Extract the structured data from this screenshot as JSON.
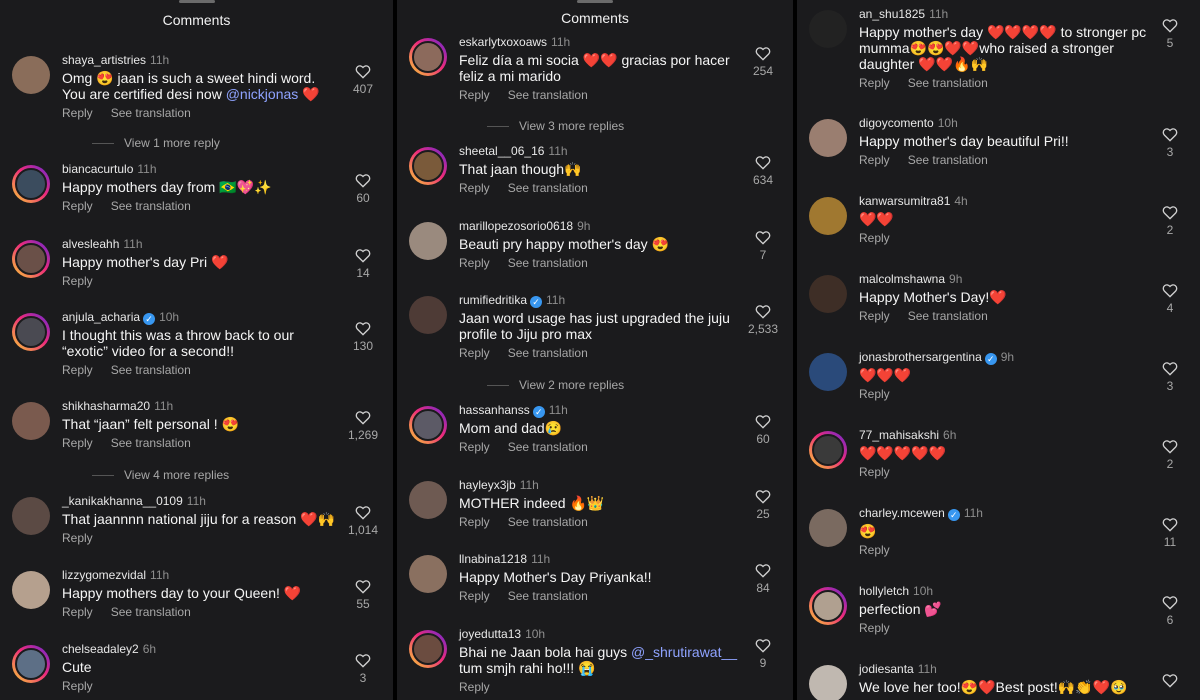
{
  "panels": [
    {
      "title": "Comments",
      "comments": [
        {
          "user": "shaya_artistries",
          "time": "11h",
          "verified": false,
          "text": "Omg 😍 jaan is such a sweet hindi word. You are certified desi now",
          "mention": "@nickjonas",
          "tail": " ❤️",
          "reply": "Reply",
          "translate": "See translation",
          "likes": "407",
          "more": "View 1 more reply",
          "avatar": "#8a6d5a",
          "ring": false
        },
        {
          "user": "biancacurtulo",
          "time": "11h",
          "verified": false,
          "text": "Happy mothers day from 🇧🇷💖✨",
          "reply": "Reply",
          "translate": "See translation",
          "likes": "60",
          "avatar": "#3b4c5e",
          "ring": true
        },
        {
          "user": "alvesleahh",
          "time": "11h",
          "verified": false,
          "text": "Happy mother's day Pri ❤️",
          "reply": "Reply",
          "likes": "14",
          "avatar": "#6a5048",
          "ring": true
        },
        {
          "user": "anjula_acharia",
          "time": "10h",
          "verified": true,
          "text": "I thought this was a throw back to our “exotic” video for a second!!",
          "reply": "Reply",
          "translate": "See translation",
          "likes": "130",
          "avatar": "#4a4a52",
          "ring": true
        },
        {
          "user": "shikhasharma20",
          "time": "11h",
          "verified": false,
          "text": "That “jaan” felt personal ! 😍",
          "reply": "Reply",
          "translate": "See translation",
          "likes": "1,269",
          "more": "View 4 more replies",
          "avatar": "#7a5a4e",
          "ring": false
        },
        {
          "user": "_kanikakhanna__0109",
          "time": "11h",
          "verified": false,
          "text": "That jaannnn national jiju for a reason ❤️🙌",
          "reply": "Reply",
          "likes": "1,014",
          "avatar": "#5b4a44",
          "ring": false
        },
        {
          "user": "lizzygomezvidal",
          "time": "11h",
          "verified": false,
          "text": "Happy mothers day to your Queen! ❤️",
          "reply": "Reply",
          "translate": "See translation",
          "likes": "55",
          "avatar": "#b5a08e",
          "ring": false
        },
        {
          "user": "chelseadaley2",
          "time": "6h",
          "verified": false,
          "text": "Cute",
          "reply": "Reply",
          "likes": "3",
          "avatar": "#5d6f86",
          "ring": true
        }
      ]
    },
    {
      "title": "Comments",
      "comments": [
        {
          "user": "eskarlytxoxoaws",
          "time": "11h",
          "verified": false,
          "text": "Feliz día a mi socia ❤️❤️ gracias por hacer feliz a mi marido",
          "reply": "Reply",
          "translate": "See translation",
          "likes": "254",
          "more": "View 3 more replies",
          "avatar": "#8c6a5c",
          "ring": true
        },
        {
          "user": "sheetal__06_16",
          "time": "11h",
          "verified": false,
          "text": "That jaan though🙌",
          "reply": "Reply",
          "translate": "See translation",
          "likes": "634",
          "avatar": "#7a5a3a",
          "ring": true
        },
        {
          "user": "marillopezosorio0618",
          "time": "9h",
          "verified": false,
          "text": "Beauti pry happy mother's day 😍",
          "reply": "Reply",
          "translate": "See translation",
          "likes": "7",
          "avatar": "#9a8a7e",
          "ring": false
        },
        {
          "user": "rumifiedritika",
          "time": "11h",
          "verified": true,
          "text": "Jaan word usage has just upgraded the juju profile to Jiju pro max",
          "reply": "Reply",
          "translate": "See translation",
          "likes": "2,533",
          "more": "View 2 more replies",
          "avatar": "#4e3b36",
          "ring": false
        },
        {
          "user": "hassanhanss",
          "time": "11h",
          "verified": true,
          "text": "Mom and dad😢",
          "reply": "Reply",
          "translate": "See translation",
          "likes": "60",
          "avatar": "#5c5a66",
          "ring": true
        },
        {
          "user": "hayleyx3jb",
          "time": "11h",
          "verified": false,
          "text": "MOTHER indeed 🔥👑",
          "reply": "Reply",
          "translate": "See translation",
          "likes": "25",
          "avatar": "#6e5a52",
          "ring": false
        },
        {
          "user": "llnabina1218",
          "time": "11h",
          "verified": false,
          "text": "Happy Mother's Day Priyanka!!",
          "reply": "Reply",
          "translate": "See translation",
          "likes": "84",
          "avatar": "#8a7060",
          "ring": false
        },
        {
          "user": "joyedutta13",
          "time": "10h",
          "verified": false,
          "text": "Bhai ne Jaan bola hai guys",
          "mention": "@_shrutirawat__",
          "tail": " tum smjh rahi ho!!! 😭",
          "reply": "Reply",
          "likes": "9",
          "avatar": "#6b4c40",
          "ring": true
        }
      ]
    },
    {
      "title": "",
      "comments": [
        {
          "user": "an_shu1825",
          "time": "11h",
          "verified": false,
          "text": "Happy mother's day ❤️❤️❤️❤️ to stronger pc mumma😍😍❤️❤️who raised a stronger daughter ❤️❤️🔥🙌",
          "reply": "Reply",
          "translate": "See translation",
          "likes": "5",
          "avatar": "#222222",
          "ring": false
        },
        {
          "user": "digoycomento",
          "time": "10h",
          "verified": false,
          "text": "Happy mother's day beautiful Pri!!",
          "reply": "Reply",
          "translate": "See translation",
          "likes": "3",
          "avatar": "#9a7e70",
          "ring": false
        },
        {
          "user": "kanwarsumitra81",
          "time": "4h",
          "verified": false,
          "text": "❤️❤️",
          "reply": "Reply",
          "likes": "2",
          "avatar": "#a07830",
          "ring": false
        },
        {
          "user": "malcolmshawna",
          "time": "9h",
          "verified": false,
          "text": "Happy Mother's Day!❤️",
          "reply": "Reply",
          "translate": "See translation",
          "likes": "4",
          "avatar": "#3e2e26",
          "ring": false
        },
        {
          "user": "jonasbrothersargentina",
          "time": "9h",
          "verified": true,
          "text": "❤️❤️❤️",
          "reply": "Reply",
          "likes": "3",
          "avatar": "#2a4a7a",
          "ring": false
        },
        {
          "user": "77_mahisakshi",
          "time": "6h",
          "verified": false,
          "text": "❤️❤️❤️❤️❤️",
          "reply": "Reply",
          "likes": "2",
          "avatar": "#3a3a3a",
          "ring": true
        },
        {
          "user": "charley.mcewen",
          "time": "11h",
          "verified": true,
          "text": "😍",
          "reply": "Reply",
          "likes": "11",
          "avatar": "#7a6a60",
          "ring": false
        },
        {
          "user": "hollyletch",
          "time": "10h",
          "verified": false,
          "text": "perfection 💕",
          "reply": "Reply",
          "likes": "6",
          "avatar": "#b0a090",
          "ring": true
        },
        {
          "user": "jodiesanta",
          "time": "11h",
          "verified": false,
          "text": "We love her too!😍❤️Best post!🙌👏❤️🥹",
          "reply": "Reply",
          "likes": "",
          "avatar": "#c0b8b0",
          "ring": false
        }
      ]
    }
  ]
}
